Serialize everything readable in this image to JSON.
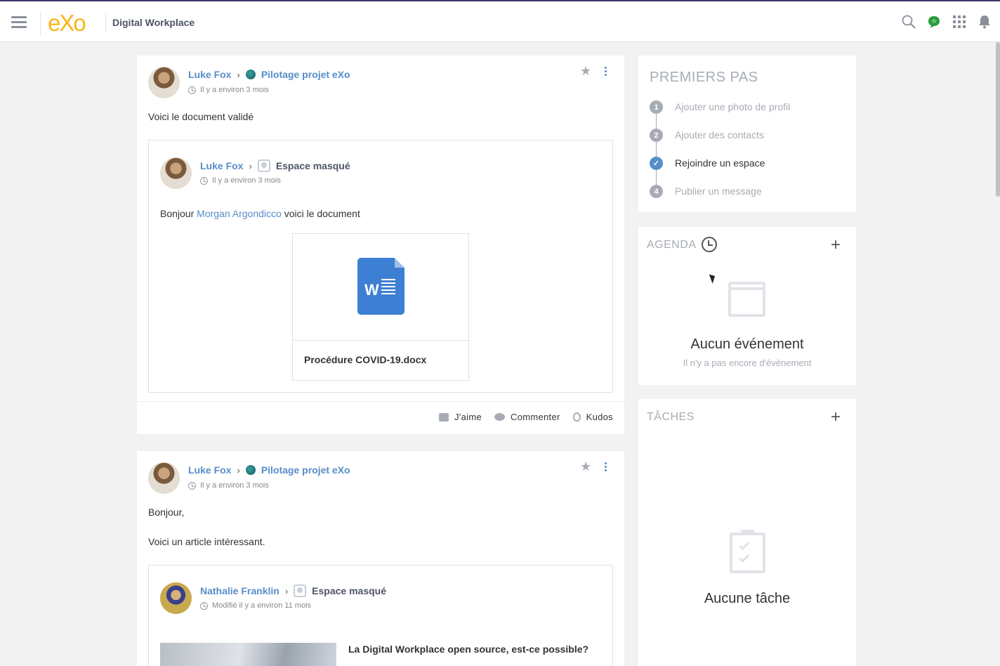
{
  "header": {
    "logo": "eXo",
    "company_name": "Digital Workplace",
    "icons": [
      "menu-icon",
      "search-icon",
      "chat-icon",
      "apps-icon",
      "notifications-icon"
    ]
  },
  "activities": [
    {
      "author": "Luke Fox",
      "space": "Pilotage projet eXo",
      "time": "Il y a environ 3 mois",
      "text": "Voici le document validé",
      "shared": {
        "author": "Luke Fox",
        "space": "Espace masqué",
        "time": "Il y a environ 3 mois",
        "text_before": "Bonjour",
        "mention": "Morgan Argondicco",
        "text_after": "voici le document",
        "document_name": "Procédure COVID-19.docx"
      },
      "actions": {
        "like": "J'aime",
        "comment": "Commenter",
        "kudos": "Kudos"
      }
    },
    {
      "author": "Luke Fox",
      "space": "Pilotage projet eXo",
      "time": "Il y a environ 3 mois",
      "line1": "Bonjour,",
      "line2": "Voici un article intéressant.",
      "shared": {
        "author": "Nathalie Franklin",
        "space": "Espace masqué",
        "time": "Modifié il y a environ 11 mois",
        "article_title": "La Digital Workplace open source, est-ce possible?"
      }
    }
  ],
  "getting_started": {
    "title": "PREMIERS PAS",
    "steps": [
      {
        "num": "1",
        "label": "Ajouter une photo de profil",
        "done": false
      },
      {
        "num": "2",
        "label": "Ajouter des contacts",
        "done": false
      },
      {
        "num": "3",
        "label": "Rejoindre un espace",
        "done": true
      },
      {
        "num": "4",
        "label": "Publier un message",
        "done": false
      }
    ]
  },
  "agenda": {
    "title": "AGENDA",
    "empty_title": "Aucun événement",
    "empty_subtitle": "Il n'y a pas encore d'évènement"
  },
  "tasks": {
    "title": "TÂCHES",
    "empty_title": "Aucune tâche"
  }
}
